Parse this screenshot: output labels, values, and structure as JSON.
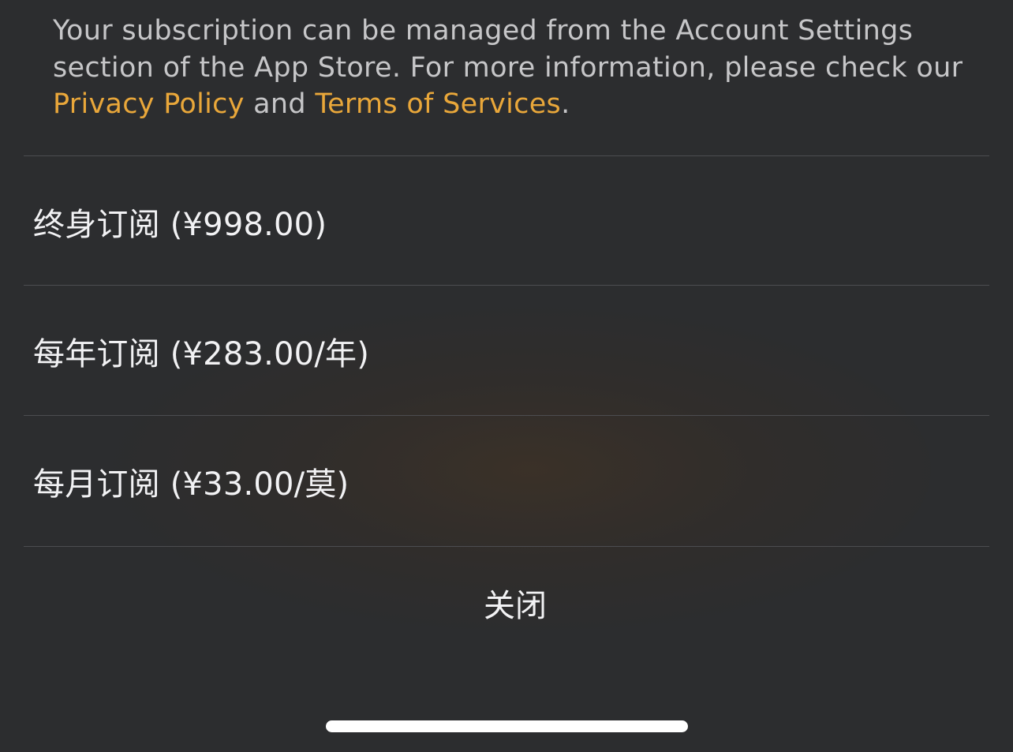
{
  "notice": {
    "text_before": "Your subscription can be managed from the Account Settings section of the App Store. For more information, please check our ",
    "privacy_link": "Privacy Policy",
    "text_between": " and ",
    "terms_link": "Terms of Services",
    "text_after": "."
  },
  "options": [
    {
      "label": "终身订阅 (¥998.00)"
    },
    {
      "label": "每年订阅 (¥283.00/年)"
    },
    {
      "label": "每月订阅 (¥33.00/莫)"
    }
  ],
  "close_label": "关闭",
  "colors": {
    "background": "#2c2d2f",
    "text": "#f2f2f4",
    "muted_text": "#c6c6c8",
    "link": "#e9a73a",
    "divider": "#4c4d50"
  }
}
